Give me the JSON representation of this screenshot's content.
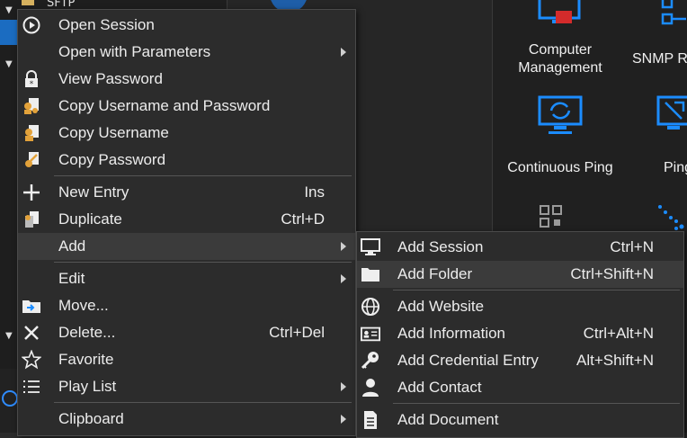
{
  "tree": {
    "top_label": "SFTP"
  },
  "tiles": [
    {
      "label_lines": [
        "Computer",
        "Management"
      ],
      "icon": "computer-management-icon"
    },
    {
      "label_lines": [
        "SNMP R"
      ],
      "icon": "snmp-icon"
    },
    {
      "label_lines": [
        "Continuous Ping"
      ],
      "icon": "continuous-ping-icon"
    },
    {
      "label_lines": [
        "Ping"
      ],
      "icon": "ping-icon"
    }
  ],
  "menu": {
    "items": [
      {
        "label": "Open Session",
        "shortcut": "",
        "icon": "play-circle-icon"
      },
      {
        "label": "Open with Parameters",
        "shortcut": "",
        "icon": "",
        "submenu": true
      },
      {
        "label": "View Password",
        "shortcut": "",
        "icon": "lock-icon"
      },
      {
        "label": "Copy Username and Password",
        "shortcut": "",
        "icon": "copy-credentials-icon"
      },
      {
        "label": "Copy Username",
        "shortcut": "",
        "icon": "copy-username-icon"
      },
      {
        "label": "Copy Password",
        "shortcut": "",
        "icon": "copy-password-icon"
      },
      {
        "label": "New Entry",
        "shortcut": "Ins",
        "icon": "plus-icon"
      },
      {
        "label": "Duplicate",
        "shortcut": "Ctrl+D",
        "icon": "duplicate-icon"
      },
      {
        "label": "Add",
        "shortcut": "",
        "icon": "",
        "submenu": true,
        "highlighted": true
      },
      {
        "label": "Edit",
        "shortcut": "",
        "icon": "",
        "submenu": true
      },
      {
        "label": "Move...",
        "shortcut": "",
        "icon": "move-folder-icon"
      },
      {
        "label": "Delete...",
        "shortcut": "Ctrl+Del",
        "icon": "close-icon"
      },
      {
        "label": "Favorite",
        "shortcut": "",
        "icon": "star-icon"
      },
      {
        "label": "Play List",
        "shortcut": "",
        "icon": "list-icon",
        "submenu": true
      },
      {
        "label": "Clipboard",
        "shortcut": "",
        "icon": "",
        "submenu": true
      }
    ]
  },
  "submenu": {
    "items": [
      {
        "label": "Add Session",
        "shortcut": "Ctrl+N",
        "icon": "monitor-icon"
      },
      {
        "label": "Add Folder",
        "shortcut": "Ctrl+Shift+N",
        "icon": "folder-icon",
        "highlighted": true
      },
      {
        "label": "Add Website",
        "shortcut": "",
        "icon": "globe-icon"
      },
      {
        "label": "Add Information",
        "shortcut": "Ctrl+Alt+N",
        "icon": "id-card-icon"
      },
      {
        "label": "Add Credential Entry",
        "shortcut": "Alt+Shift+N",
        "icon": "key-icon"
      },
      {
        "label": "Add Contact",
        "shortcut": "",
        "icon": "person-icon"
      },
      {
        "label": "Add Document",
        "shortcut": "",
        "icon": "document-icon"
      }
    ]
  },
  "colors": {
    "accent_blue": "#1b8cff",
    "highlight": "#3b3b3b",
    "menu_bg": "#2c2c2c"
  }
}
